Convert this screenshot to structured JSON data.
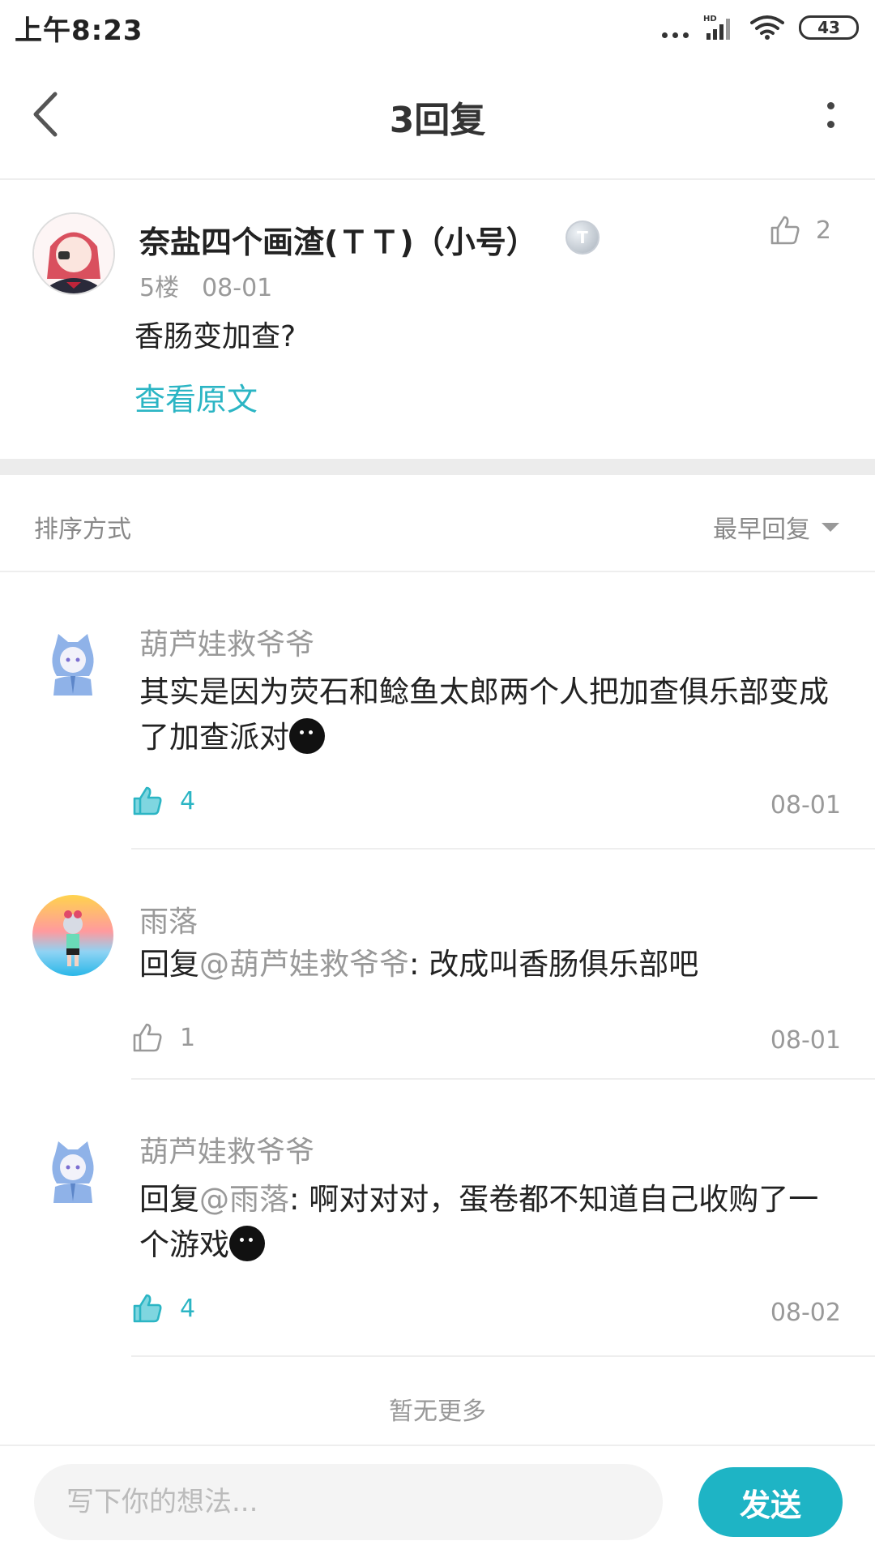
{
  "status_bar": {
    "time": "上午8:23",
    "network": "HD",
    "battery": "43"
  },
  "header": {
    "title": "3回复"
  },
  "post": {
    "author": "奈盐四个画渣(ＴＴ)（小号）",
    "badge": "T",
    "floor": "5楼",
    "date": "08-01",
    "content": "香肠变加查?",
    "view_original": "查看原文",
    "likes": "2"
  },
  "sort": {
    "label": "排序方式",
    "value": "最早回复"
  },
  "replies": [
    {
      "user": "葫芦娃救爷爷",
      "text": "其实是因为荧石和鲶鱼太郎两个人把加查俱乐部变成了加查派对",
      "likes": "4",
      "date": "08-01",
      "liked": true
    },
    {
      "user": "雨落",
      "reply_prefix": "回复",
      "mention": "@葫芦娃救爷爷",
      "text": ": 改成叫香肠俱乐部吧",
      "likes": "1",
      "date": "08-01",
      "liked": false
    },
    {
      "user": "葫芦娃救爷爷",
      "reply_prefix": "回复",
      "mention": "@雨落",
      "text": ": 啊对对对，蛋卷都不知道自己收购了一个游戏",
      "likes": "4",
      "date": "08-02",
      "liked": true
    }
  ],
  "footer": {
    "no_more": "暂无更多"
  },
  "input": {
    "placeholder": "写下你的想法...",
    "send_label": "发送"
  },
  "colors": {
    "accent": "#2bb5c4",
    "send_button": "#1eb4c5"
  }
}
